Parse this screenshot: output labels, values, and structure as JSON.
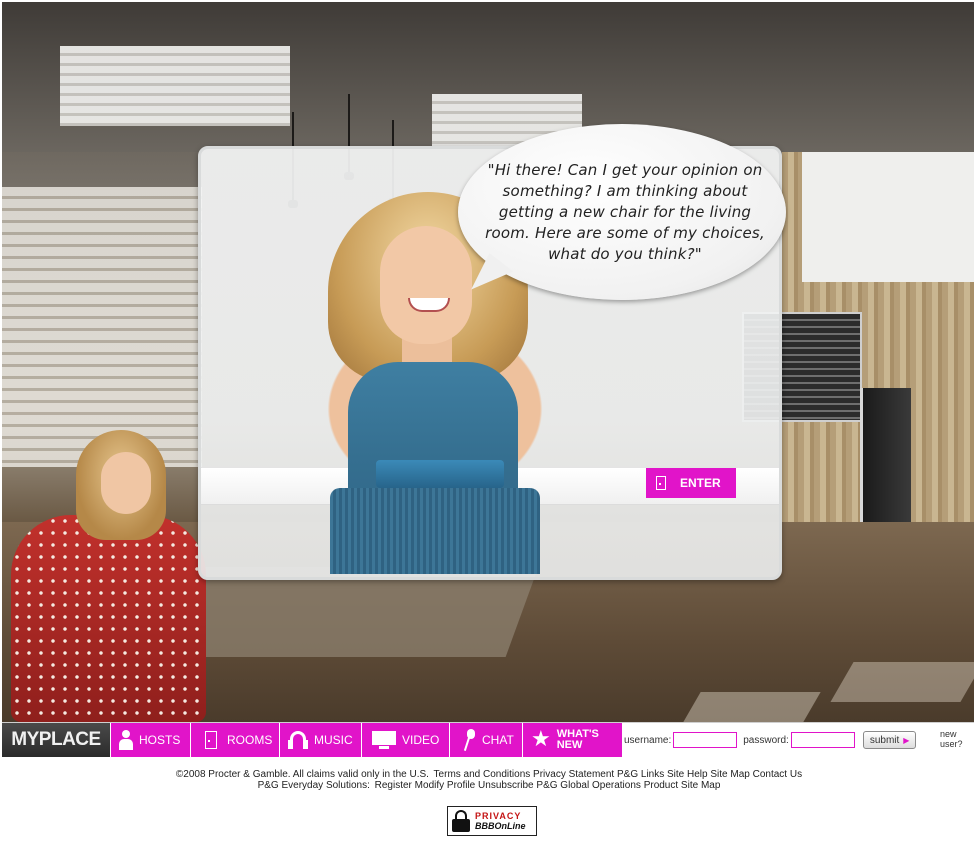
{
  "hero": {
    "speech": "\"Hi there! Can I get your opinion on something? I am thinking about getting a new chair for the living room.  Here are some of my choices, what do you think?\"",
    "enter_label": "ENTER"
  },
  "nav": {
    "brand": "MYPLACE",
    "items": [
      {
        "label": "HOSTS",
        "icon": "person-icon"
      },
      {
        "label": "ROOMS",
        "icon": "door-icon"
      },
      {
        "label": "MUSIC",
        "icon": "headphones-icon"
      },
      {
        "label": "VIDEO",
        "icon": "monitor-icon"
      },
      {
        "label": "CHAT",
        "icon": "microphone-icon"
      },
      {
        "label": "WHAT'S NEW",
        "icon": "star-icon"
      }
    ],
    "accent_color": "#e114c9"
  },
  "login": {
    "username_label": "username:",
    "password_label": "password:",
    "submit_label": "submit",
    "new_user_label": "new user?"
  },
  "footer": {
    "row1": {
      "copyright": "©2008 Procter & Gamble. All claims valid only in the U.S.",
      "links": [
        "Terms and Conditions",
        "Privacy Statement",
        "P&G Links",
        "Site Help",
        "Site Map",
        "Contact Us"
      ]
    },
    "row2": {
      "prefix": "P&G Everyday Solutions:",
      "links": [
        "Register",
        "Modify Profile",
        "Unsubscribe",
        "P&G Global Operations",
        "Product Site Map"
      ]
    },
    "badge": {
      "top": "PRIVACY",
      "bottom": "BBBOnLine"
    }
  }
}
